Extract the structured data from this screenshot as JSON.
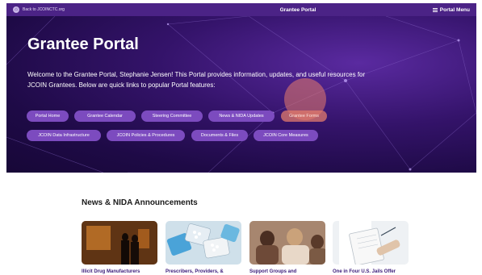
{
  "topbar": {
    "back_label": "Back to JCOINCTC.org",
    "title": "Grantee Portal",
    "menu_label": "Portal Menu"
  },
  "hero": {
    "title": "Grantee Portal",
    "intro": "Welcome to the Grantee Portal, Stephanie Jensen! This Portal provides information, updates, and useful resources for JCOIN Grantees. Below are quick links to popular Portal features:",
    "links": [
      "Portal Home",
      "Grantee Calendar",
      "Steering Committee",
      "News & NIDA Updates",
      "Grantee Forms",
      "JCOIN Data Infrastructure",
      "JCOIN Policies & Procedures",
      "Documents & Files",
      "JCOIN Core Measures"
    ]
  },
  "news": {
    "title": "News & NIDA Announcements",
    "cards": [
      {
        "caption": "Illicit Drug Manufacturers"
      },
      {
        "caption": "Prescribers, Providers, &"
      },
      {
        "caption": "Support Groups and"
      },
      {
        "caption": "One in Four U.S. Jails Offer"
      }
    ]
  },
  "colors": {
    "topbar": "#4b2386",
    "pill": "#7c4bbf",
    "pill_highlight": "#e27b6c",
    "card_caption": "#3a1a7a"
  }
}
